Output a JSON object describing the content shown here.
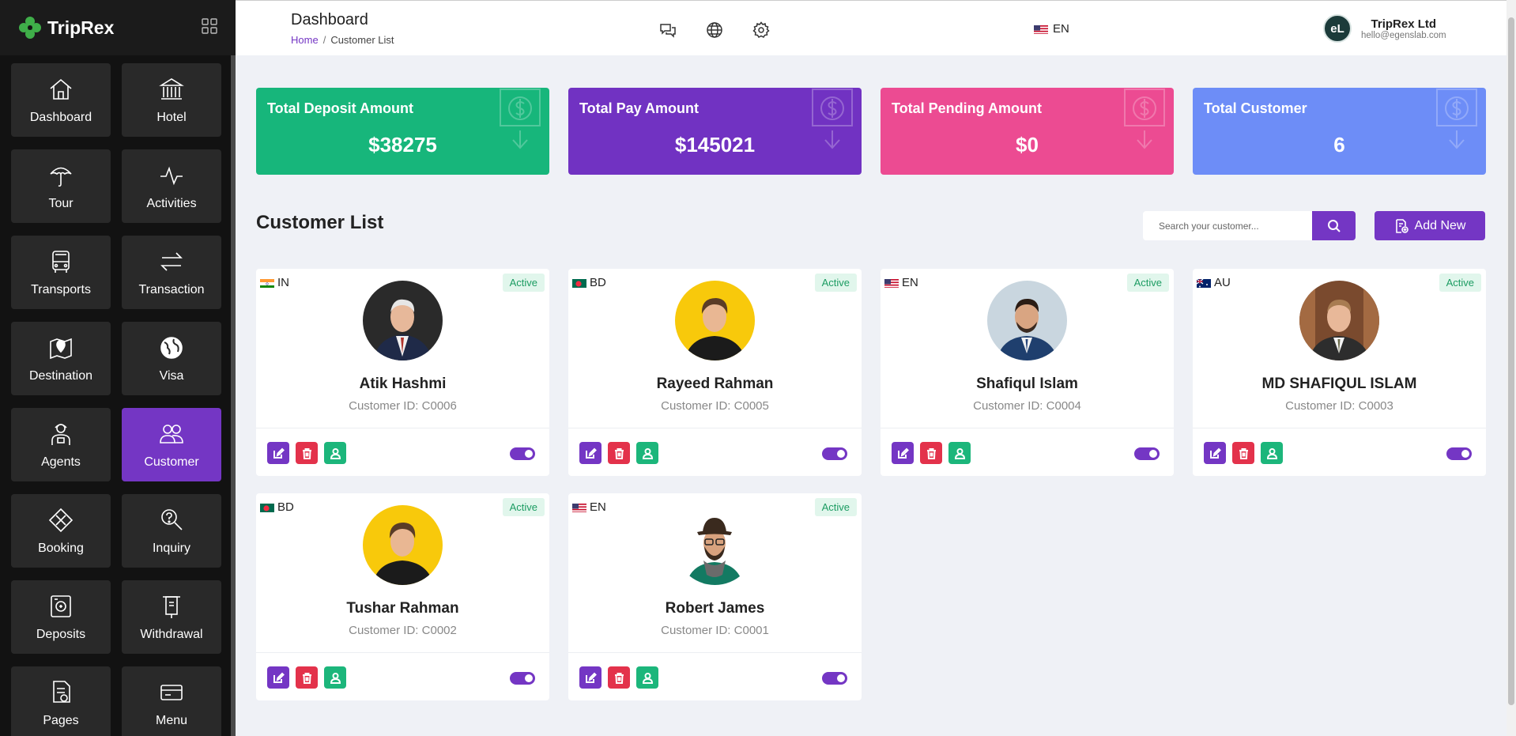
{
  "brand": {
    "name": "TripRex"
  },
  "sidebar": {
    "items": [
      {
        "label": "Dashboard",
        "icon": "home-icon",
        "active": false
      },
      {
        "label": "Hotel",
        "icon": "building-icon",
        "active": false
      },
      {
        "label": "Tour",
        "icon": "umbrella-icon",
        "active": false
      },
      {
        "label": "Activities",
        "icon": "activity-icon",
        "active": false
      },
      {
        "label": "Transports",
        "icon": "bus-icon",
        "active": false
      },
      {
        "label": "Transaction",
        "icon": "transfer-arrows-icon",
        "active": false
      },
      {
        "label": "Destination",
        "icon": "map-pin-icon",
        "active": false
      },
      {
        "label": "Visa",
        "icon": "globe-icon",
        "active": false
      },
      {
        "label": "Agents",
        "icon": "agent-icon",
        "active": false
      },
      {
        "label": "Customer",
        "icon": "users-icon",
        "active": true
      },
      {
        "label": "Booking",
        "icon": "booking-icon",
        "active": false
      },
      {
        "label": "Inquiry",
        "icon": "inquiry-icon",
        "active": false
      },
      {
        "label": "Deposits",
        "icon": "deposit-icon",
        "active": false
      },
      {
        "label": "Withdrawal",
        "icon": "withdrawal-icon",
        "active": false
      },
      {
        "label": "Pages",
        "icon": "pages-icon",
        "active": false
      },
      {
        "label": "Menu",
        "icon": "menu-card-icon",
        "active": false
      }
    ]
  },
  "header": {
    "title": "Dashboard",
    "breadcrumb": {
      "home": "Home",
      "separator": "/",
      "current": "Customer List"
    },
    "language": "EN",
    "user": {
      "name": "TripRex Ltd",
      "email": "hello@egenslab.com",
      "initials": "eL"
    }
  },
  "stats": [
    {
      "label": "Total Deposit Amount",
      "value": "$38275",
      "color": "#17b67b"
    },
    {
      "label": "Total Pay Amount",
      "value": "$145021",
      "color": "#7132c2"
    },
    {
      "label": "Total Pending Amount",
      "value": "$0",
      "color": "#ec4b92"
    },
    {
      "label": "Total Customer",
      "value": "6",
      "color": "#6d8df7"
    }
  ],
  "customer_list": {
    "title": "Customer List",
    "search_placeholder": "Search your customer...",
    "add_label": "Add New",
    "customers": [
      {
        "name": "Atik Hashmi",
        "id": "Customer ID: C0006",
        "country": "IN",
        "status": "Active",
        "enabled": true
      },
      {
        "name": "Rayeed Rahman",
        "id": "Customer ID: C0005",
        "country": "BD",
        "status": "Active",
        "enabled": true
      },
      {
        "name": "Shafiqul Islam",
        "id": "Customer ID: C0004",
        "country": "EN",
        "status": "Active",
        "enabled": true
      },
      {
        "name": "MD SHAFIQUL ISLAM",
        "id": "Customer ID: C0003",
        "country": "AU",
        "status": "Active",
        "enabled": true
      },
      {
        "name": "Tushar Rahman",
        "id": "Customer ID: C0002",
        "country": "BD",
        "status": "Active",
        "enabled": true
      },
      {
        "name": "Robert James",
        "id": "Customer ID: C0001",
        "country": "EN",
        "status": "Active",
        "enabled": true
      }
    ]
  },
  "colors": {
    "accent": "#7436c4",
    "sidebar_bg": "#121212",
    "tile_bg": "#292929",
    "danger": "#e3324b",
    "success": "#1cb67b"
  }
}
